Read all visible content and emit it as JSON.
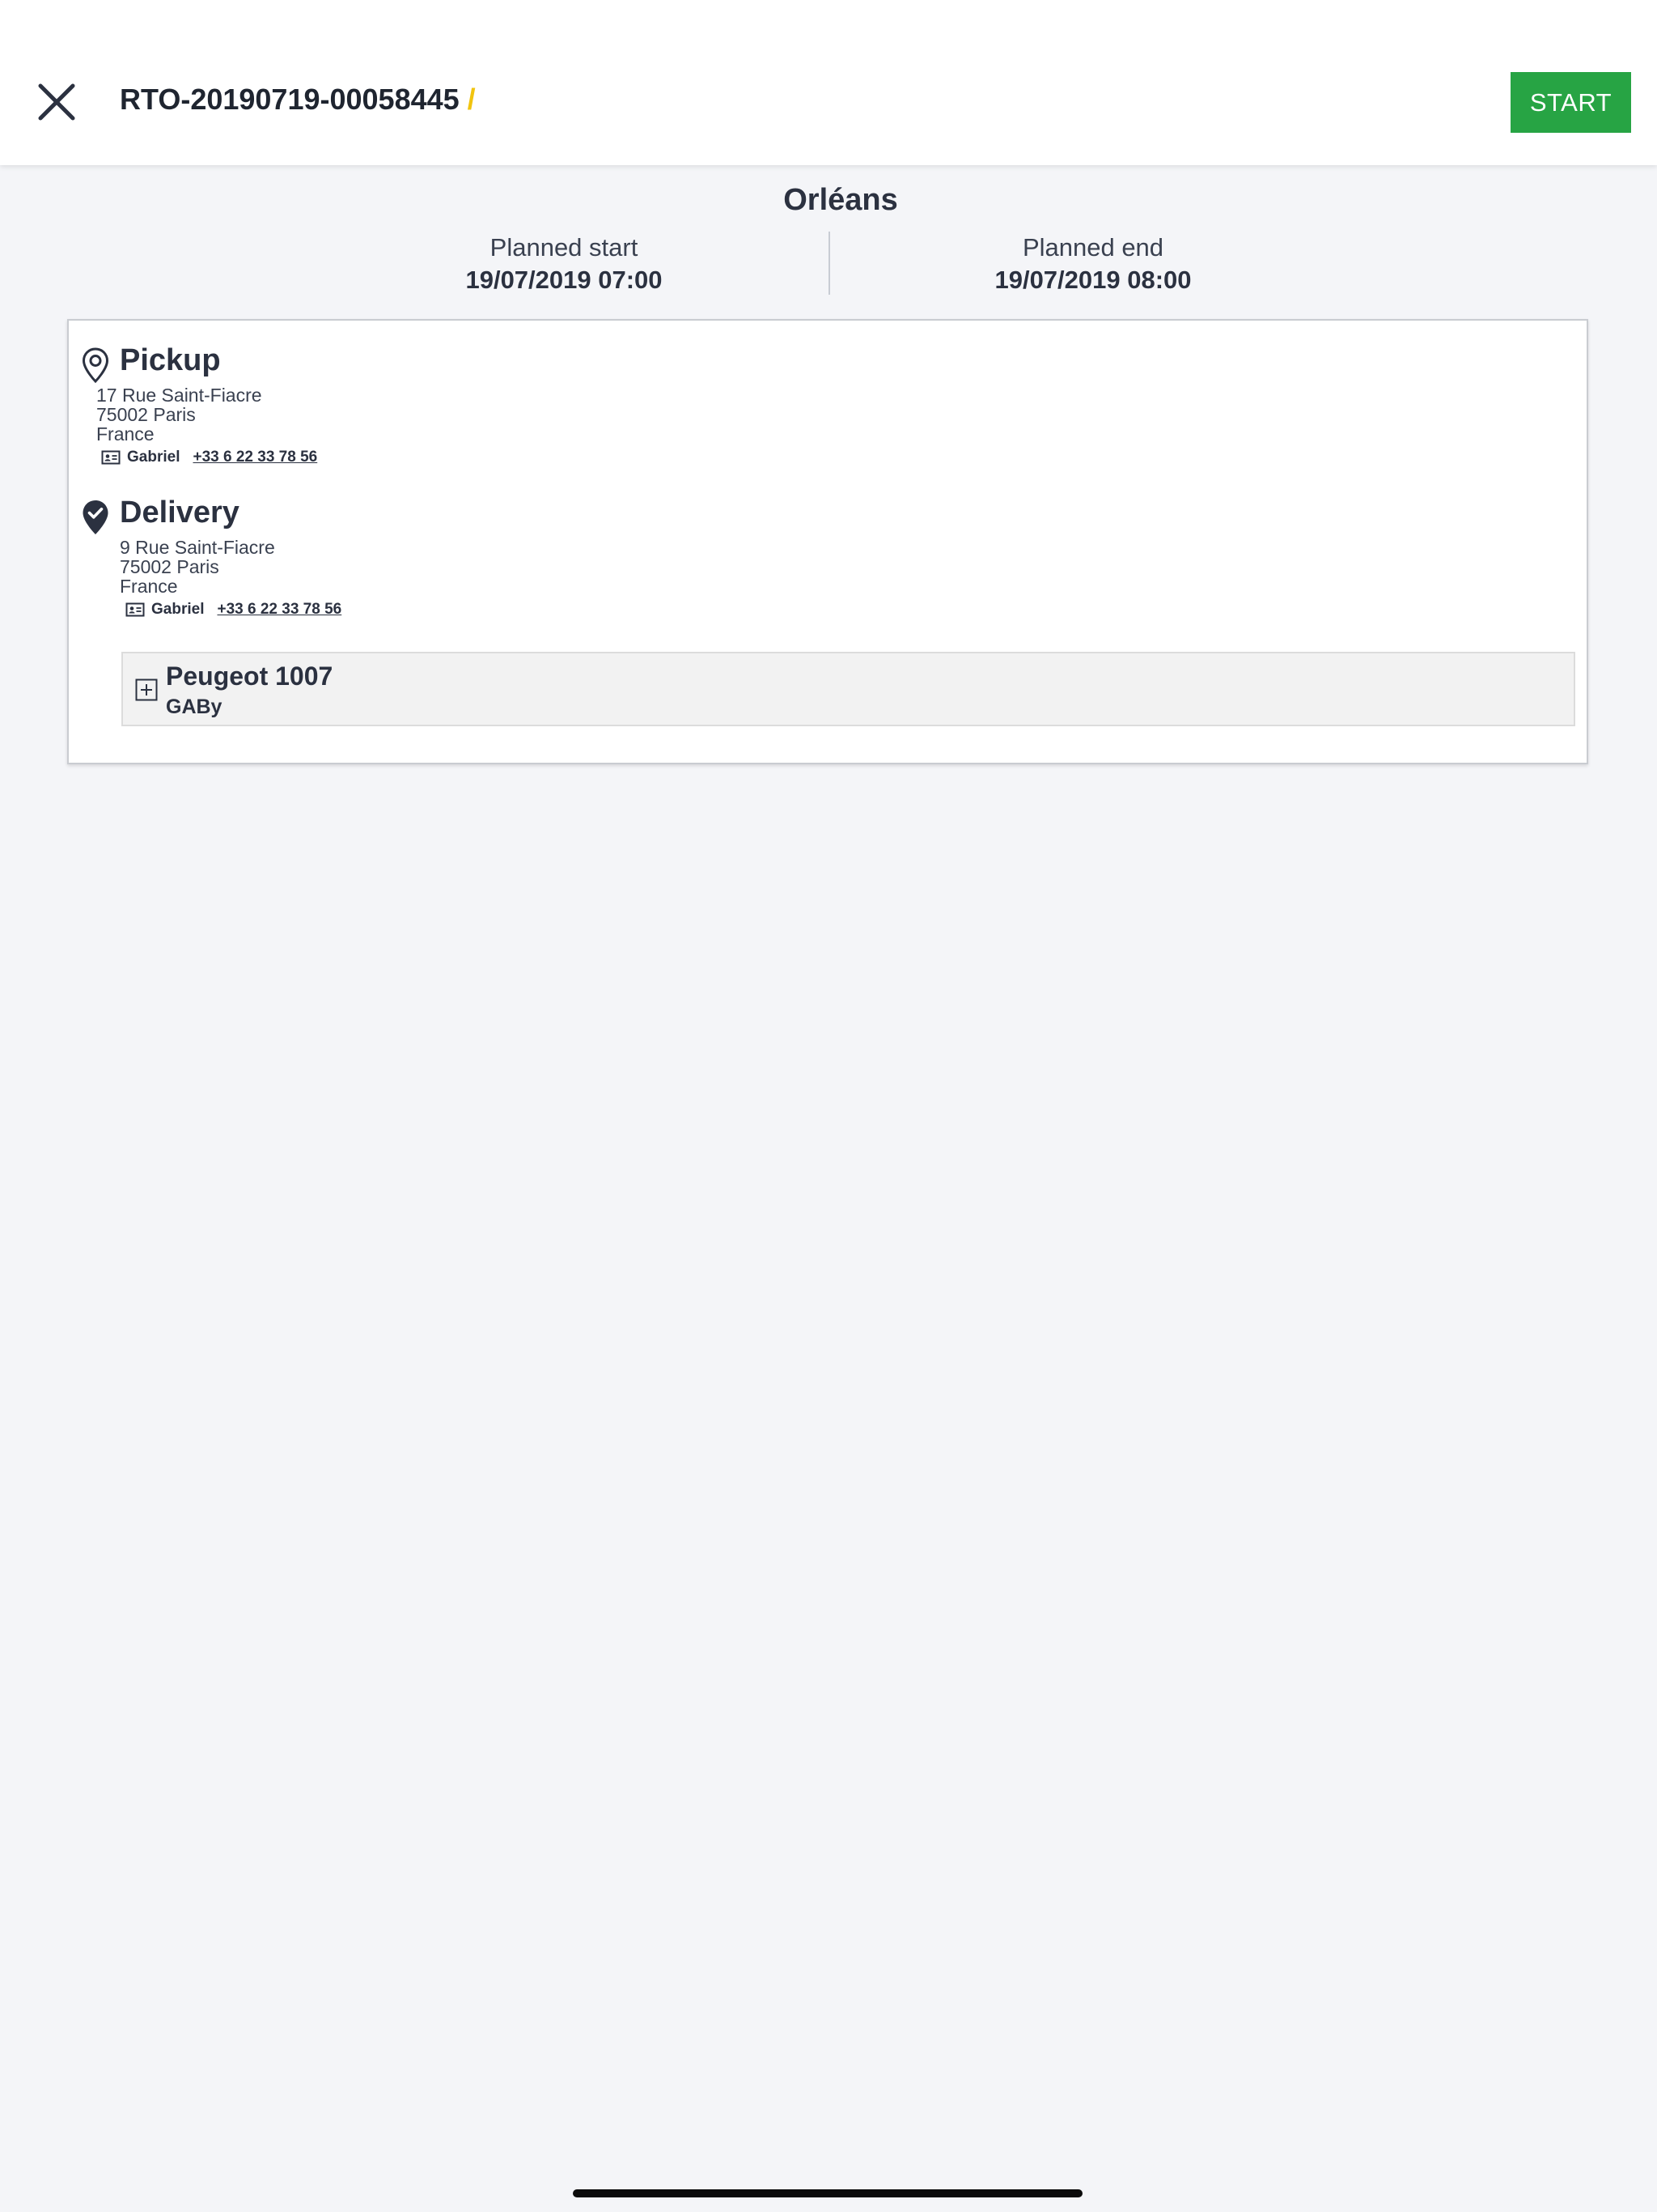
{
  "header": {
    "reference": "RTO-20190719-00058445",
    "separator": "/",
    "start_label": "START"
  },
  "summary": {
    "city": "Orléans",
    "planned_start": {
      "label": "Planned start",
      "value": "19/07/2019 07:00"
    },
    "planned_end": {
      "label": "Planned end",
      "value": "19/07/2019 08:00"
    }
  },
  "pickup": {
    "title": "Pickup",
    "icon": "map-pin-outline-icon",
    "address_line1": "17 Rue Saint-Fiacre",
    "address_line2": "75002 Paris",
    "address_line3": "France",
    "contact_name": "Gabriel",
    "contact_phone": "+33 6 22 33 78 56"
  },
  "delivery": {
    "title": "Delivery",
    "icon": "map-pin-check-icon",
    "address_line1": "9 Rue Saint-Fiacre",
    "address_line2": "75002 Paris",
    "address_line3": "France",
    "contact_name": "Gabriel",
    "contact_phone": "+33 6 22 33 78 56"
  },
  "vehicle": {
    "name": "Peugeot 1007",
    "plate": "GABy",
    "icon": "plus-square-icon"
  },
  "colors": {
    "accent_green": "#27a444",
    "separator_yellow": "#f1c40f",
    "text_dark": "#2b3140",
    "background": "#f4f5f8"
  }
}
